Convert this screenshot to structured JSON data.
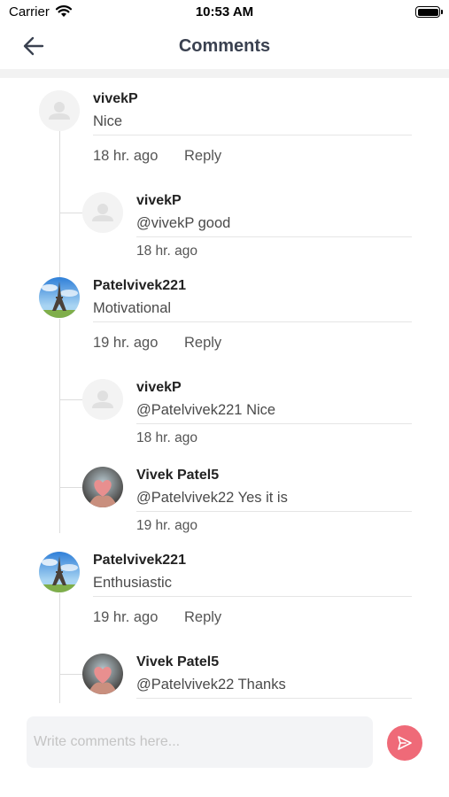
{
  "status_bar": {
    "carrier": "Carrier",
    "time": "10:53 AM"
  },
  "header": {
    "title": "Comments"
  },
  "colors": {
    "accent": "#ef6a78",
    "title": "#3a4150",
    "line": "#dcdcdc"
  },
  "comments": [
    {
      "user": "vivekP",
      "text": "Nice",
      "time": "18 hr. ago",
      "reply_label": "Reply",
      "avatar": "placeholder-avatar",
      "replies": [
        {
          "user": "vivekP",
          "text": "@vivekP good",
          "time": "18 hr. ago",
          "avatar": "placeholder-avatar"
        }
      ]
    },
    {
      "user": "Patelvivek221",
      "text": "Motivational",
      "time": "19 hr. ago",
      "reply_label": "Reply",
      "avatar": "eiffel-tower-avatar",
      "replies": [
        {
          "user": "vivekP",
          "text": "@Patelvivek221 Nice",
          "time": "18 hr. ago",
          "avatar": "placeholder-avatar"
        },
        {
          "user": "Vivek Patel5",
          "text": "@Patelvivek22 Yes it is",
          "time": "19 hr. ago",
          "avatar": "heart-photo-avatar"
        }
      ]
    },
    {
      "user": "Patelvivek221",
      "text": "Enthusiastic",
      "time": "19 hr. ago",
      "reply_label": "Reply",
      "avatar": "eiffel-tower-avatar",
      "replies": [
        {
          "user": "Vivek Patel5",
          "text": "@Patelvivek22 Thanks",
          "time": "",
          "avatar": "heart-photo-avatar"
        }
      ]
    }
  ],
  "composer": {
    "placeholder": "Write comments here..."
  }
}
